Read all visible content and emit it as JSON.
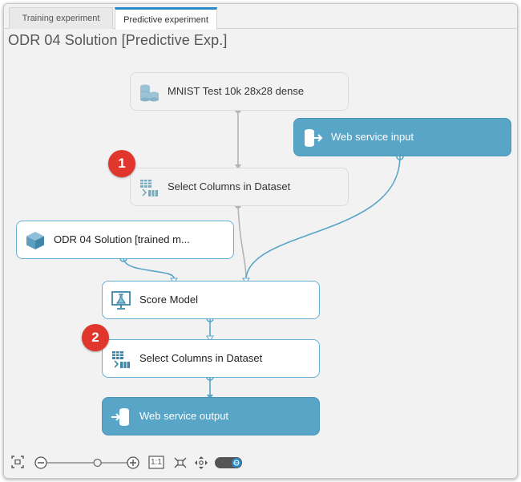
{
  "tabs": [
    {
      "label": "Training experiment"
    },
    {
      "label": "Predictive experiment"
    }
  ],
  "experiment_title": "ODR 04 Solution [Predictive Exp.]",
  "nodes": {
    "mnist": "MNIST Test 10k 28x28 dense",
    "web_input": "Web service input",
    "select1": "Select Columns in Dataset",
    "trained_model": "ODR 04 Solution [trained m...",
    "score": "Score Model",
    "select2": "Select Columns in Dataset",
    "web_output": "Web service output"
  },
  "badges": [
    "1",
    "2"
  ],
  "toolbar": {
    "zoom_reset_label": "1:1",
    "zoom_level_fraction": 0.63
  },
  "colors": {
    "accent_blue": "#58a5c7",
    "node_border_blue": "#67b0d3",
    "badge_red": "#e0362c",
    "connector_grey": "#b4b4b4"
  }
}
